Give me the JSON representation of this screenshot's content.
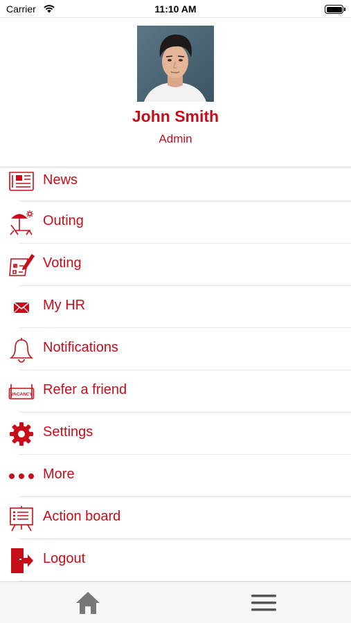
{
  "status_bar": {
    "carrier": "Carrier",
    "time": "11:10 AM",
    "icons": [
      "wifi-icon",
      "battery-icon"
    ]
  },
  "profile": {
    "name": "John Smith",
    "role": "Admin",
    "avatar": "profile-photo"
  },
  "menu": {
    "items": [
      {
        "label": "News",
        "icon": "newspaper-icon"
      },
      {
        "label": "Outing",
        "icon": "beach-lounger-icon"
      },
      {
        "label": "Voting",
        "icon": "ballot-pencil-icon"
      },
      {
        "label": "My HR",
        "icon": "envelope-icon"
      },
      {
        "label": "Notifications",
        "icon": "bell-icon"
      },
      {
        "label": "Refer a friend",
        "icon": "vacancy-sign-icon"
      },
      {
        "label": "Settings",
        "icon": "gear-icon"
      },
      {
        "label": "More",
        "icon": "more-dots-icon"
      },
      {
        "label": "Action board",
        "icon": "easel-board-icon"
      },
      {
        "label": "Logout",
        "icon": "logout-door-icon"
      }
    ]
  },
  "tab_bar": {
    "items": [
      {
        "name": "home",
        "icon": "home-icon"
      },
      {
        "name": "menu",
        "icon": "hamburger-menu-icon"
      }
    ]
  },
  "colors": {
    "accent": "#c70d1a",
    "divider": "#e6e6e6",
    "tab_icon": "#777777",
    "tab_bar_bg": "#f7f7f7"
  },
  "icon_text": {
    "vacancy": "VACANCY"
  }
}
